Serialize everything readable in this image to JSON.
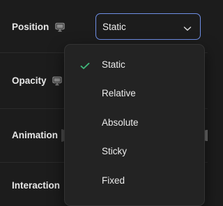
{
  "fields": {
    "position": {
      "label": "Position"
    },
    "opacity": {
      "label": "Opacity"
    },
    "animation": {
      "label": "Animation"
    },
    "interaction": {
      "label": "Interaction"
    }
  },
  "position_select": {
    "value": "Static",
    "icon": "chevron-down-icon"
  },
  "dropdown": {
    "selected": "Static",
    "options": [
      "Static",
      "Relative",
      "Absolute",
      "Sticky",
      "Fixed"
    ]
  },
  "colors": {
    "background": "#1c1c1c",
    "menu_background": "#232323",
    "accent_border": "#6f8fe6",
    "check": "#3fb77a",
    "text": "#e8e8e8"
  }
}
